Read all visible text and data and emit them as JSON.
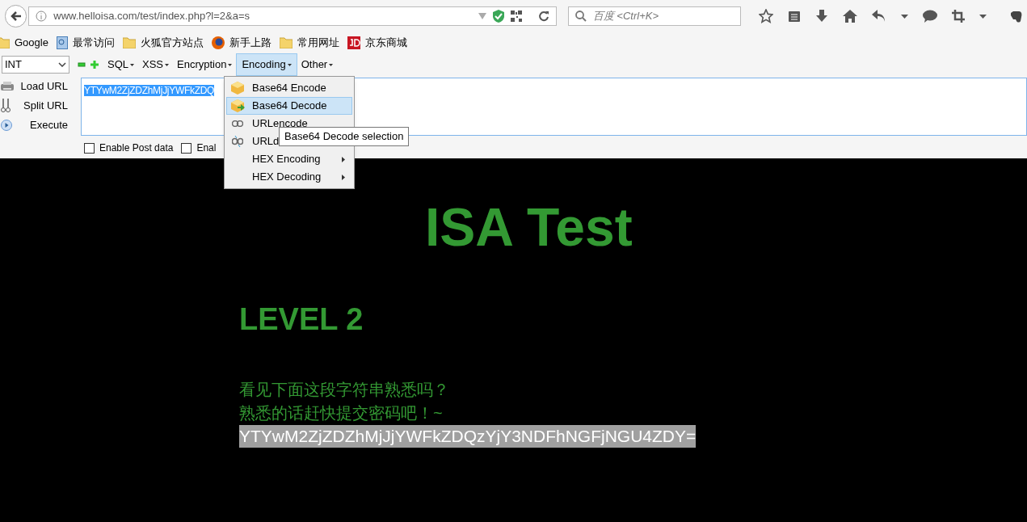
{
  "address_bar": {
    "url": "www.helloisa.com/test/index.php?l=2&a=s"
  },
  "search": {
    "placeholder": "百度 <Ctrl+K>"
  },
  "bookmarks": [
    {
      "label": "Google",
      "kind": "folder"
    },
    {
      "label": "最常访问",
      "kind": "page"
    },
    {
      "label": "火狐官方站点",
      "kind": "folder"
    },
    {
      "label": "新手上路",
      "kind": "firefox"
    },
    {
      "label": "常用网址",
      "kind": "folder"
    },
    {
      "label": "京东商城",
      "kind": "jd"
    }
  ],
  "hackbar": {
    "select": "INT",
    "menus": [
      {
        "label": "SQL",
        "selected": false
      },
      {
        "label": "XSS",
        "selected": false
      },
      {
        "label": "Encryption",
        "selected": false
      },
      {
        "label": "Encoding",
        "selected": true
      },
      {
        "label": "Other",
        "selected": false
      }
    ],
    "actions": [
      {
        "label": "Load URL",
        "kind": "load"
      },
      {
        "label": "Split URL",
        "kind": "split"
      },
      {
        "label": "Execute",
        "kind": "execute"
      }
    ],
    "url_text": "YTYwM2ZjZDZhMjJjYWFkZDQ",
    "checkboxes": [
      {
        "label": "Enable Post data",
        "checked": false
      },
      {
        "label": "Enal",
        "checked": false
      }
    ]
  },
  "encoding_menu": [
    {
      "label": "Base64 Encode",
      "kind": "box",
      "selected": false,
      "submenu": false
    },
    {
      "label": "Base64 Decode",
      "kind": "box-arrow",
      "selected": true,
      "submenu": false
    },
    {
      "label": "URLencode",
      "kind": "link",
      "selected": false,
      "submenu": false
    },
    {
      "label": "URLd",
      "kind": "broken-link",
      "selected": false,
      "submenu": false
    },
    {
      "label": "HEX Encoding",
      "kind": "none",
      "selected": false,
      "submenu": true
    },
    {
      "label": "HEX Decoding",
      "kind": "none",
      "selected": false,
      "submenu": true
    }
  ],
  "tooltip": "Base64 Decode selection",
  "page": {
    "title": "ISA Test",
    "level": "LEVEL 2",
    "lines": [
      "看见下面这段字符串熟悉吗？",
      "熟悉的话赶快提交密码吧！~"
    ],
    "code": "YTYwM2ZjZDZhMjJjYWFkZDQzYjY3NDFhNGFjNGU4ZDY="
  }
}
